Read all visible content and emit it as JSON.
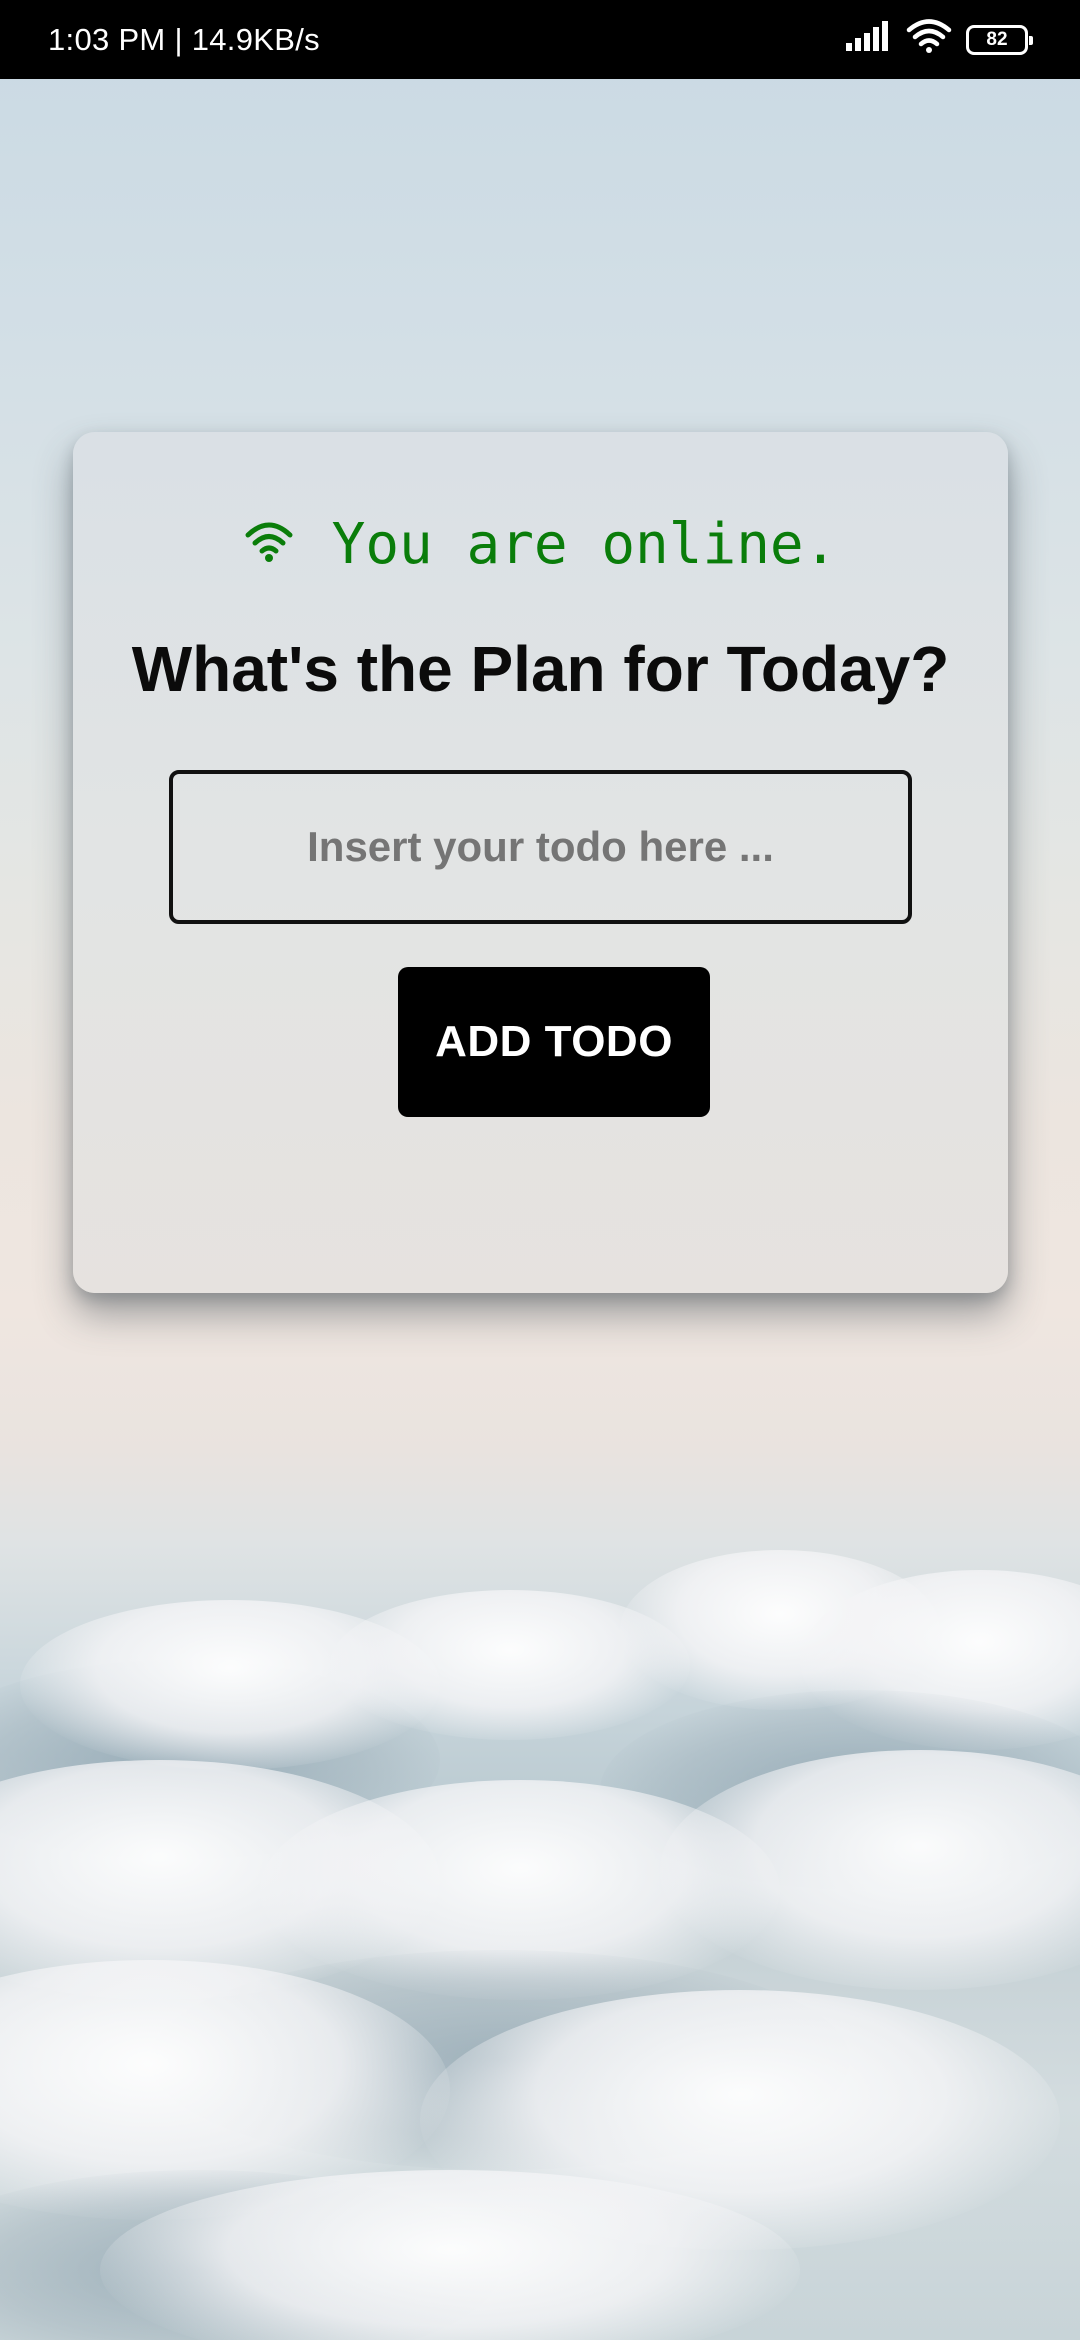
{
  "status_bar": {
    "time_speed": "1:03 PM | 14.9KB/s",
    "battery_level": "82",
    "icons": [
      "signal-icon",
      "wifi-icon",
      "battery-icon"
    ]
  },
  "card": {
    "connection_status": "You are online.",
    "connection_icon": "wifi-icon",
    "connection_color": "#0a7d0a",
    "heading": "What's the Plan for Today?",
    "todo_input": {
      "value": "",
      "placeholder": "Insert your todo here ..."
    },
    "add_button_label": "ADD TODO"
  }
}
